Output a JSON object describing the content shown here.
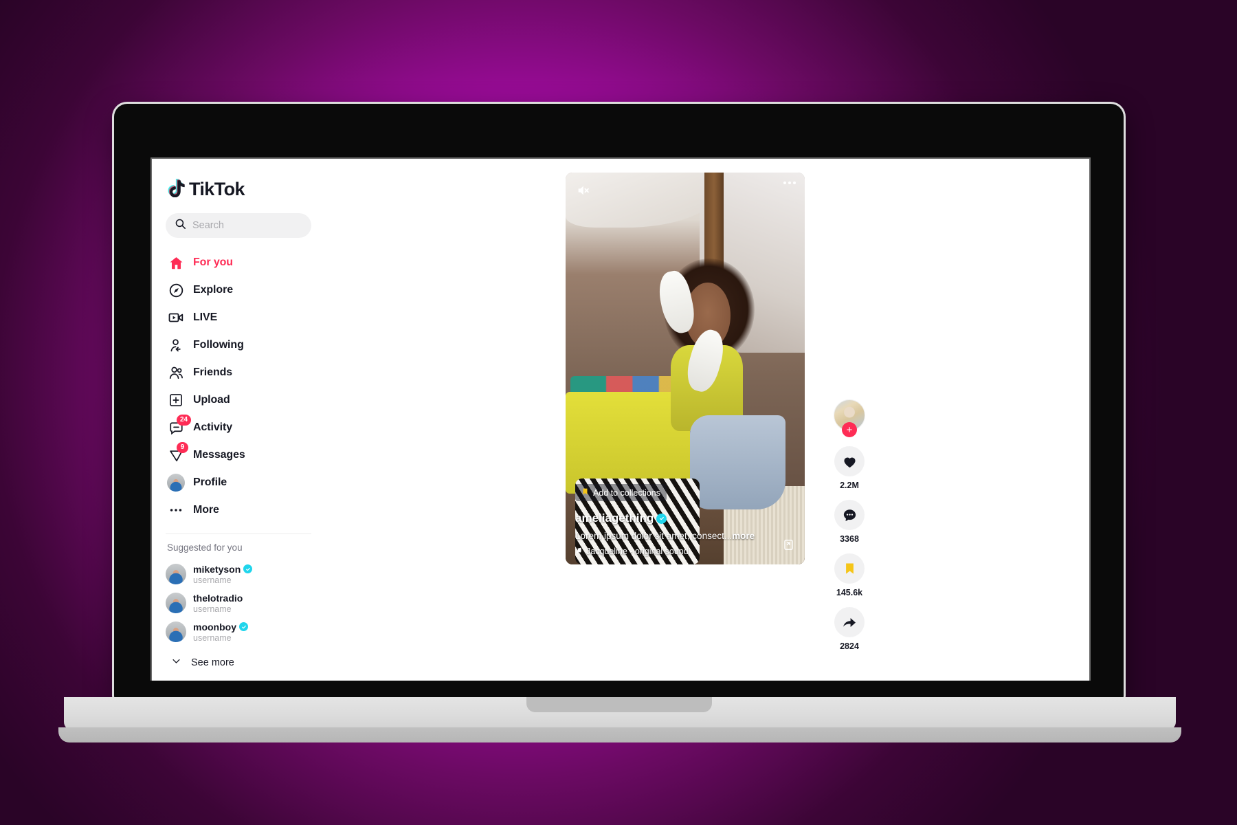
{
  "theme": {
    "brand_pink": "#fe2c55",
    "verified_blue": "#20d5ec",
    "bookmark_yellow": "#f5c518",
    "bg_magenta": "#e818e8",
    "bg_dark_purple": "#2a0427"
  },
  "app": {
    "logo_text": "TikTok"
  },
  "search": {
    "placeholder": "Search",
    "value": "",
    "icon": "search-icon"
  },
  "sidebar": {
    "nav": [
      {
        "label": "For you",
        "icon": "home-icon",
        "active": true,
        "badge": ""
      },
      {
        "label": "Explore",
        "icon": "compass-icon",
        "active": false,
        "badge": ""
      },
      {
        "label": "LIVE",
        "icon": "live-video-icon",
        "active": false,
        "badge": ""
      },
      {
        "label": "Following",
        "icon": "person-add-icon",
        "active": false,
        "badge": ""
      },
      {
        "label": "Friends",
        "icon": "people-icon",
        "active": false,
        "badge": ""
      },
      {
        "label": "Upload",
        "icon": "plus-box-icon",
        "active": false,
        "badge": ""
      },
      {
        "label": "Activity",
        "icon": "inbox-icon",
        "active": false,
        "badge": "24"
      },
      {
        "label": "Messages",
        "icon": "send-icon",
        "active": false,
        "badge": "9"
      },
      {
        "label": "Profile",
        "icon": "avatar-icon",
        "active": false,
        "badge": ""
      },
      {
        "label": "More",
        "icon": "ellipsis-icon",
        "active": false,
        "badge": ""
      }
    ],
    "suggested_title": "Suggested for you",
    "suggested": [
      {
        "name": "miketyson",
        "sub": "username",
        "verified": true
      },
      {
        "name": "thelotradio",
        "sub": "username",
        "verified": false
      },
      {
        "name": "moonboy",
        "sub": "username",
        "verified": true
      }
    ],
    "see_more_label": "See more",
    "see_more_icon": "chevron-down-icon"
  },
  "video": {
    "mute_icon": "mute-speaker-icon",
    "more_icon": "ellipsis-horizontal-icon",
    "expand_icon": "expand-screen-icon",
    "collections_label": "Add to collections",
    "collections_icon": "bookmark-icon",
    "author": "ameliagething",
    "author_verified": true,
    "description": "Lorem ipsum dolor sit amet, consect...",
    "description_more": "more",
    "music_icon": "music-note-icon",
    "music": "Jacqueline - original sound"
  },
  "actions": {
    "follow_icon": "plus-icon",
    "items": [
      {
        "icon": "heart-icon",
        "count": "2.2M",
        "name": "like"
      },
      {
        "icon": "comment-icon",
        "count": "3368",
        "name": "comment"
      },
      {
        "icon": "bookmark-icon",
        "count": "145.6k",
        "name": "favorite"
      },
      {
        "icon": "share-icon",
        "count": "2824",
        "name": "share"
      }
    ]
  }
}
